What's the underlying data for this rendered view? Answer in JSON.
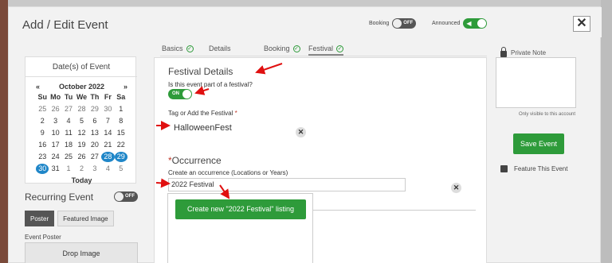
{
  "header": {
    "title": "Add / Edit Event",
    "booking_label": "Booking",
    "booking_state": "OFF",
    "announced_label": "Announced",
    "close_symbol": "✕"
  },
  "dates": {
    "title": "Date(s) of Event",
    "prev": "«",
    "next": "»",
    "month": "October 2022",
    "weekdays": [
      "Su",
      "Mo",
      "Tu",
      "We",
      "Th",
      "Fr",
      "Sa"
    ],
    "weeks": [
      [
        "25",
        "26",
        "27",
        "28",
        "29",
        "30",
        "1"
      ],
      [
        "2",
        "3",
        "4",
        "5",
        "6",
        "7",
        "8"
      ],
      [
        "9",
        "10",
        "11",
        "12",
        "13",
        "14",
        "15"
      ],
      [
        "16",
        "17",
        "18",
        "19",
        "20",
        "21",
        "22"
      ],
      [
        "23",
        "24",
        "25",
        "26",
        "27",
        "28",
        "29"
      ],
      [
        "30",
        "31",
        "1",
        "2",
        "3",
        "4",
        "5"
      ]
    ],
    "today_label": "Today"
  },
  "recurring": {
    "label": "Recurring Event",
    "state": "OFF"
  },
  "media": {
    "poster_tab": "Poster",
    "featured_tab": "Featured Image",
    "poster_label": "Event Poster",
    "drop_label": "Drop Image"
  },
  "tabs": [
    {
      "label": "Basics",
      "checked": true
    },
    {
      "label": "Details",
      "checked": false
    },
    {
      "label": "Booking",
      "checked": true
    },
    {
      "label": "Festival",
      "checked": true
    }
  ],
  "festival": {
    "section_title": "Festival Details",
    "question": "Is this event part of a festival?",
    "toggle_state": "ON",
    "tag_label": "Tag or Add the Festival",
    "required_mark": "*",
    "selected_festival": "HalloweenFest",
    "clear_symbol": "✕"
  },
  "occurrence": {
    "title": "Occurrence",
    "required_mark": "*",
    "label": "Create an occurrence (Locations or Years)",
    "input_value": "2022 Festival",
    "create_button": "Create new \"2022 Festival\" listing"
  },
  "sidebar": {
    "private_note_label": "Private Note",
    "visibility_note": "Only visible to this account",
    "save_button": "Save Event",
    "feature_label": "Feature This Event"
  },
  "colors": {
    "accent_green": "#2e9b3a",
    "selected_blue": "#1f86c8",
    "arrow_red": "#e01010"
  }
}
